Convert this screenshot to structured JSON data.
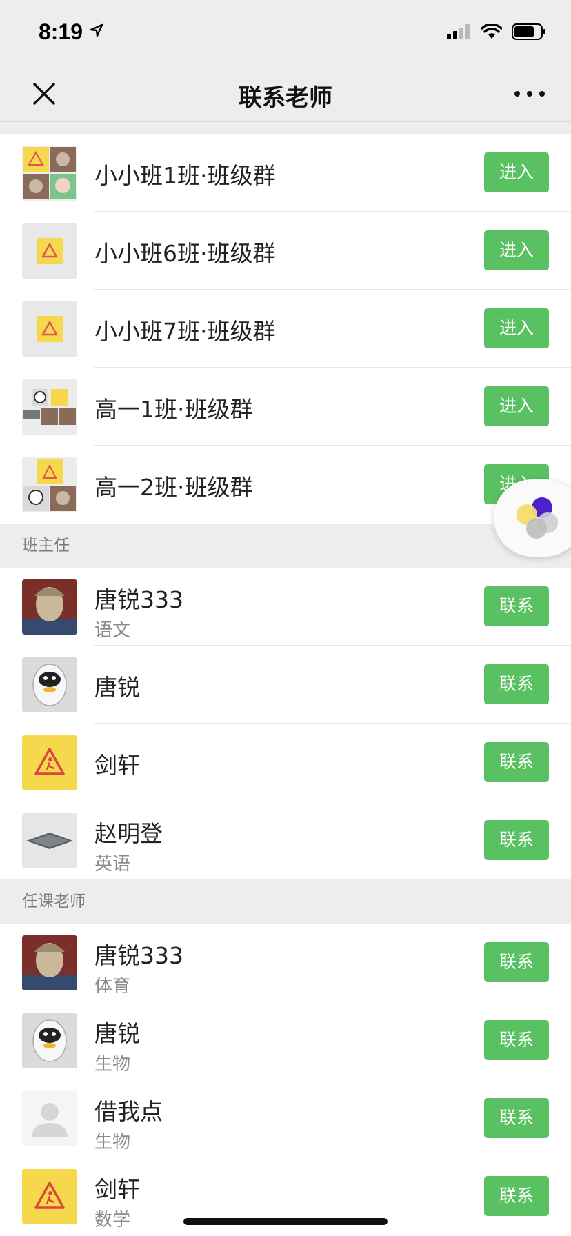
{
  "status": {
    "time": "8:19"
  },
  "nav": {
    "title": "联系老师"
  },
  "groups": [
    {
      "title": "小小班1班·班级群",
      "action": "进入",
      "avatar": "group-collage-icon"
    },
    {
      "title": "小小班6班·班级群",
      "action": "进入",
      "avatar": "warning-sign-icon"
    },
    {
      "title": "小小班7班·班级群",
      "action": "进入",
      "avatar": "warning-sign-icon"
    },
    {
      "title": "高一1班·班级群",
      "action": "进入",
      "avatar": "group-collage-icon"
    },
    {
      "title": "高一2班·班级群",
      "action": "进入",
      "avatar": "group-collage-icon"
    }
  ],
  "sections": [
    {
      "header": "班主任",
      "items": [
        {
          "name": "唐锐333",
          "subject": "语文",
          "action": "联系",
          "avatar": "statue-avatar"
        },
        {
          "name": "唐锐",
          "subject": "",
          "action": "联系",
          "avatar": "robot-avatar"
        },
        {
          "name": "剑轩",
          "subject": "",
          "action": "联系",
          "avatar": "wet-floor-sign-avatar"
        },
        {
          "name": "赵明登",
          "subject": "英语",
          "action": "联系",
          "avatar": "tile-avatar"
        }
      ]
    },
    {
      "header": "任课老师",
      "items": [
        {
          "name": "唐锐333",
          "subject": "体育",
          "action": "联系",
          "avatar": "statue-avatar"
        },
        {
          "name": "唐锐",
          "subject": "生物",
          "action": "联系",
          "avatar": "robot-avatar"
        },
        {
          "name": "借我点",
          "subject": "生物",
          "action": "联系",
          "avatar": "default-user-avatar"
        },
        {
          "name": "剑轩",
          "subject": "数学",
          "action": "联系",
          "avatar": "wet-floor-sign-avatar"
        }
      ]
    }
  ],
  "colors": {
    "accent": "#5ac162",
    "background": "#ededed",
    "warning_yellow": "#f5d84c"
  }
}
